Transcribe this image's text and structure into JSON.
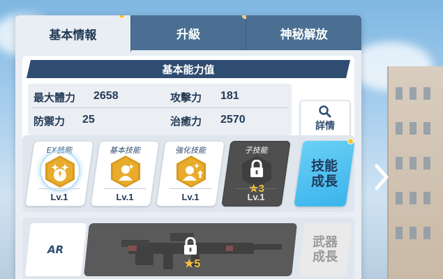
{
  "tabs": [
    {
      "label": "基本情報",
      "active": true,
      "badge": true
    },
    {
      "label": "升級",
      "active": false,
      "badge": true
    },
    {
      "label": "神秘解放",
      "active": false,
      "badge": false
    }
  ],
  "stats": {
    "banner": "基本能力值",
    "max_hp_label": "最大體力",
    "max_hp_value": "2658",
    "attack_label": "攻擊力",
    "attack_value": "181",
    "defense_label": "防禦力",
    "defense_value": "25",
    "heal_label": "治癒力",
    "heal_value": "2570",
    "detail_label": "詳情"
  },
  "skills": [
    {
      "title": "EX技能",
      "level": "Lv.1",
      "locked": false,
      "icon": "ex-skill-icon"
    },
    {
      "title": "基本技能",
      "level": "Lv.1",
      "locked": false,
      "icon": "basic-skill-icon"
    },
    {
      "title": "強化技能",
      "level": "Lv.1",
      "locked": false,
      "icon": "enhance-skill-icon"
    },
    {
      "title": "子技能",
      "level": "Lv.1",
      "locked": true,
      "icon": "lock-icon",
      "star_requirement": "3"
    }
  ],
  "skill_growth_label": "技能\n成長",
  "weapon": {
    "type": "AR",
    "locked": true,
    "star_requirement": "5",
    "growth_label": "武器\n成長"
  },
  "colors": {
    "accent_blue": "#3ab4ec",
    "tab_inactive": "#4a6f93",
    "badge_yellow": "#f6c23a",
    "skill_gold": "#e9ab2b"
  }
}
